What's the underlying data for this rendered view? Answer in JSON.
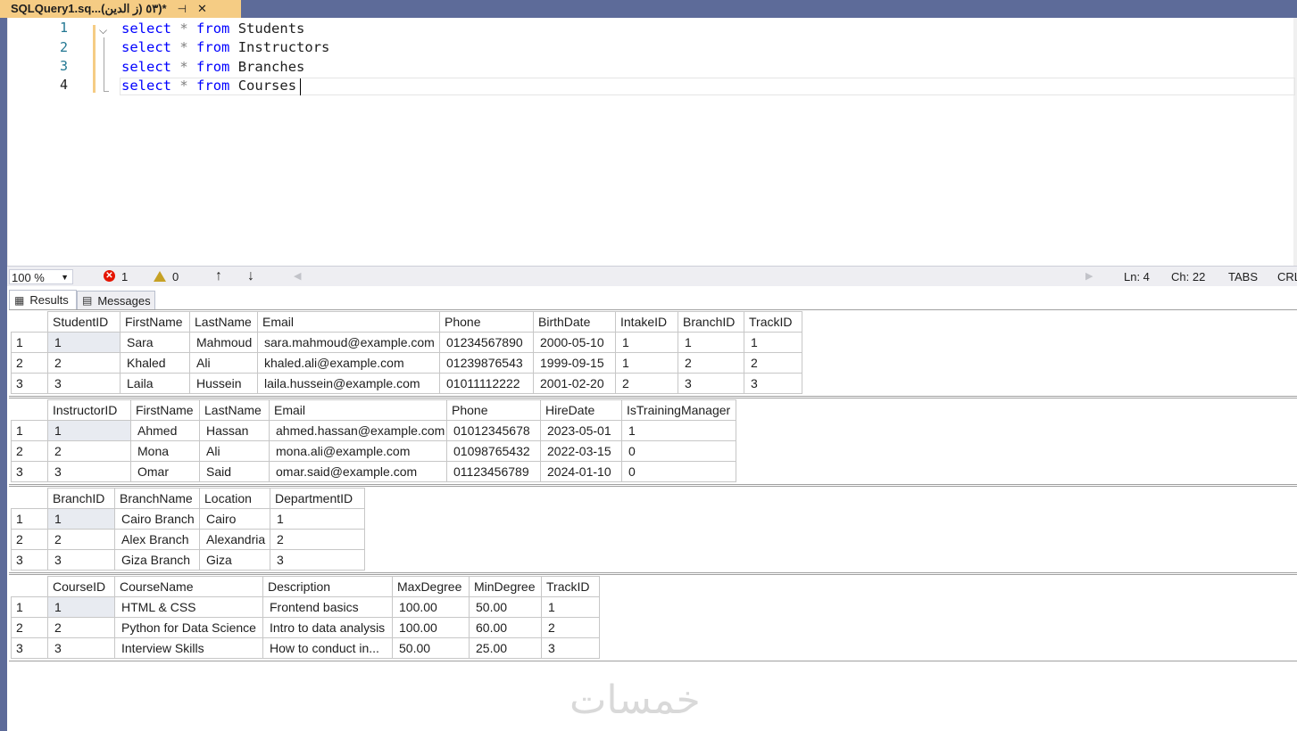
{
  "tab": {
    "title": "SQLQuery1.sq...٥٣ (ز الدين))*",
    "pin_icon": "pin-icon",
    "close_icon": "close-icon"
  },
  "editor": {
    "line_numbers": [
      "1",
      "2",
      "3",
      "4"
    ],
    "lines": [
      {
        "kw1": "select",
        "op": "*",
        "kw2": "from",
        "id": "Students"
      },
      {
        "kw1": "select",
        "op": "*",
        "kw2": "from",
        "id": "Instructors"
      },
      {
        "kw1": "select",
        "op": "*",
        "kw2": "from",
        "id": "Branches"
      },
      {
        "kw1": "select",
        "op": "*",
        "kw2": "from",
        "id": "Courses"
      }
    ]
  },
  "statusbar": {
    "zoom": "100 %",
    "errors": "1",
    "warnings": "0",
    "ln": "Ln: 4",
    "ch": "Ch: 22",
    "tabs": "TABS",
    "eol": "CRL"
  },
  "results_tabs": {
    "results": "Results",
    "messages": "Messages"
  },
  "grids": [
    {
      "columns": [
        "StudentID",
        "FirstName",
        "LastName",
        "Email",
        "Phone",
        "BirthDate",
        "IntakeID",
        "BranchID",
        "TrackID"
      ],
      "rows": [
        [
          "1",
          "1",
          "Sara",
          "Mahmoud",
          "sara.mahmoud@example.com",
          "01234567890",
          "2000-05-10",
          "1",
          "1",
          "1"
        ],
        [
          "2",
          "2",
          "Khaled",
          "Ali",
          "khaled.ali@example.com",
          "01239876543",
          "1999-09-15",
          "1",
          "2",
          "2"
        ],
        [
          "3",
          "3",
          "Laila",
          "Hussein",
          "laila.hussein@example.com",
          "01011112222",
          "2001-02-20",
          "2",
          "3",
          "3"
        ]
      ]
    },
    {
      "columns": [
        "InstructorID",
        "FirstName",
        "LastName",
        "Email",
        "Phone",
        "HireDate",
        "IsTrainingManager"
      ],
      "rows": [
        [
          "1",
          "1",
          "Ahmed",
          "Hassan",
          "ahmed.hassan@example.com",
          "01012345678",
          "2023-05-01",
          "1"
        ],
        [
          "2",
          "2",
          "Mona",
          "Ali",
          "mona.ali@example.com",
          "01098765432",
          "2022-03-15",
          "0"
        ],
        [
          "3",
          "3",
          "Omar",
          "Said",
          "omar.said@example.com",
          "01123456789",
          "2024-01-10",
          "0"
        ]
      ]
    },
    {
      "columns": [
        "BranchID",
        "BranchName",
        "Location",
        "DepartmentID"
      ],
      "rows": [
        [
          "1",
          "1",
          "Cairo Branch",
          "Cairo",
          "1"
        ],
        [
          "2",
          "2",
          "Alex Branch",
          "Alexandria",
          "2"
        ],
        [
          "3",
          "3",
          "Giza Branch",
          "Giza",
          "3"
        ]
      ]
    },
    {
      "columns": [
        "CourseID",
        "CourseName",
        "Description",
        "MaxDegree",
        "MinDegree",
        "TrackID"
      ],
      "rows": [
        [
          "1",
          "1",
          "HTML & CSS",
          "Frontend basics",
          "100.00",
          "50.00",
          "1"
        ],
        [
          "2",
          "2",
          "Python for Data Science",
          "Intro to data analysis",
          "100.00",
          "60.00",
          "2"
        ],
        [
          "3",
          "3",
          "Interview Skills",
          "How to conduct in...",
          "50.00",
          "25.00",
          "3"
        ]
      ]
    }
  ],
  "watermark": "خمسات"
}
